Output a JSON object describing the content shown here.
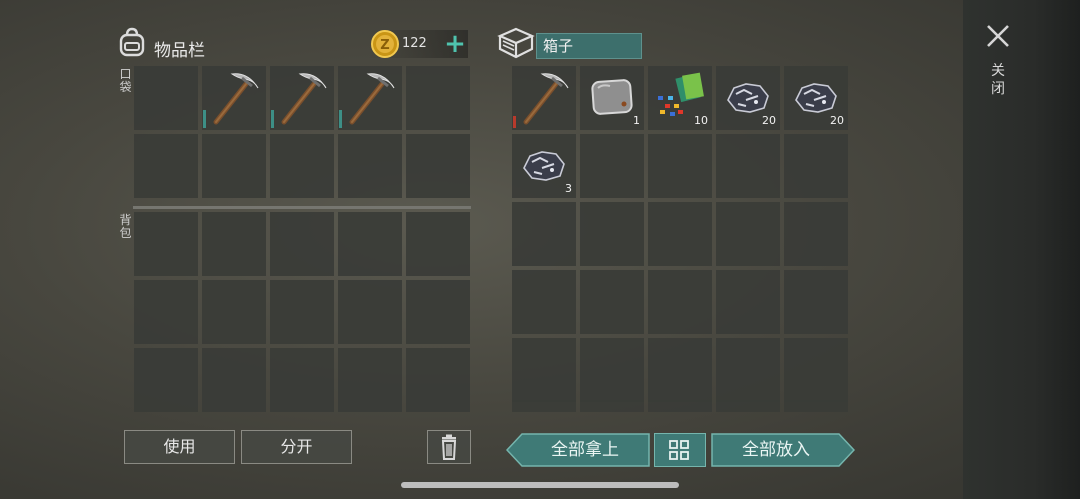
{
  "inventory": {
    "title": "物品栏",
    "coins": "122",
    "pocket_label": "口袋",
    "backpack_label": "背包",
    "pocket_slots": [
      {
        "icon": "",
        "qty": ""
      },
      {
        "icon": "pickaxe-icon",
        "qty": "",
        "durability": 0.3
      },
      {
        "icon": "pickaxe-icon",
        "qty": "",
        "durability": 0.3
      },
      {
        "icon": "pickaxe-icon",
        "qty": "",
        "durability": 0.3
      },
      {
        "icon": "",
        "qty": ""
      },
      {
        "icon": "",
        "qty": ""
      },
      {
        "icon": "",
        "qty": ""
      },
      {
        "icon": "",
        "qty": ""
      },
      {
        "icon": "",
        "qty": ""
      },
      {
        "icon": "",
        "qty": ""
      }
    ]
  },
  "container": {
    "name": "箱子",
    "slots": [
      {
        "icon": "pickaxe-icon",
        "qty": "",
        "durability": 0.2
      },
      {
        "icon": "metal-plate-icon",
        "qty": "1"
      },
      {
        "icon": "parts-pack-icon",
        "qty": "10"
      },
      {
        "icon": "ore-icon",
        "qty": "20"
      },
      {
        "icon": "ore-icon",
        "qty": "20"
      },
      {
        "icon": "ore-icon",
        "qty": "3"
      }
    ]
  },
  "buttons": {
    "use": "使用",
    "split": "分开",
    "take_all": "全部拿上",
    "put_all": "全部放入",
    "close": "关闭"
  },
  "colors": {
    "accent_teal": "#3f7a76",
    "coin_gold": "#d9a21c",
    "durability_teal": "#3d8f86",
    "durability_red": "#b83a2c"
  }
}
